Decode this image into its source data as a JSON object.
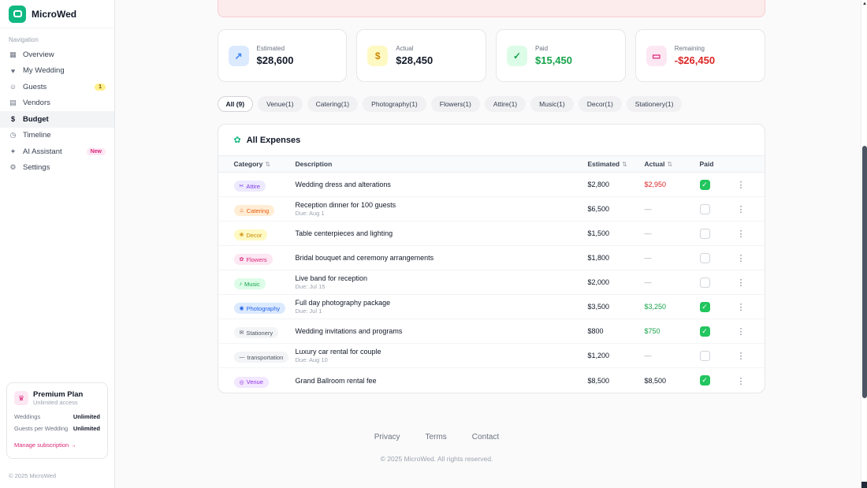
{
  "app": {
    "name": "MicroWed",
    "brand_color": "#10b981"
  },
  "sidebar": {
    "nav_label": "Navigation",
    "items": [
      {
        "label": "Overview",
        "icon": "grid-icon",
        "glyph": "▦"
      },
      {
        "label": "My Wedding",
        "icon": "heart-icon",
        "glyph": "♥"
      },
      {
        "label": "Guests",
        "icon": "users-icon",
        "glyph": "☺",
        "badge": "1",
        "badge_style": "count"
      },
      {
        "label": "Vendors",
        "icon": "store-icon",
        "glyph": "▤"
      },
      {
        "label": "Budget",
        "icon": "dollar-icon",
        "glyph": "$",
        "active": true
      },
      {
        "label": "Timeline",
        "icon": "clock-icon",
        "glyph": "◷"
      },
      {
        "label": "AI Assistant",
        "icon": "sparkles-icon",
        "glyph": "✦",
        "badge": "New",
        "badge_style": "new"
      },
      {
        "label": "Settings",
        "icon": "gear-icon",
        "glyph": "⚙"
      }
    ],
    "plan": {
      "title": "Premium Plan",
      "subtitle": "Unlimited access",
      "rows": [
        {
          "label": "Weddings",
          "value": "Unlimited"
        },
        {
          "label": "Guests per Wedding",
          "value": "Unlimited"
        }
      ],
      "manage_link": "Manage subscription →"
    },
    "copyright": "© 2025 MicroWed"
  },
  "stats": [
    {
      "label": "Estimated",
      "value": "$28,600",
      "value_color": "#111827",
      "icon": "trend-up-icon",
      "glyph": "↗",
      "icon_bg": "#dbeafe",
      "icon_color": "#3b82f6"
    },
    {
      "label": "Actual",
      "value": "$28,450",
      "value_color": "#111827",
      "icon": "dollar-icon",
      "glyph": "$",
      "icon_bg": "#fef9c3",
      "icon_color": "#ca8a04"
    },
    {
      "label": "Paid",
      "value": "$15,450",
      "value_color": "#16a34a",
      "icon": "check-circle-icon",
      "glyph": "✓",
      "icon_bg": "#dcfce7",
      "icon_color": "#16a34a"
    },
    {
      "label": "Remaining",
      "value": "-$26,450",
      "value_color": "#dc2626",
      "icon": "wallet-icon",
      "glyph": "▭",
      "icon_bg": "#fce7f3",
      "icon_color": "#db2777"
    }
  ],
  "filters": [
    {
      "label": "All (9)",
      "active": true
    },
    {
      "label": "Venue(1)"
    },
    {
      "label": "Catering(1)"
    },
    {
      "label": "Photography(1)"
    },
    {
      "label": "Flowers(1)"
    },
    {
      "label": "Attire(1)"
    },
    {
      "label": "Music(1)"
    },
    {
      "label": "Decor(1)"
    },
    {
      "label": "Stationery(1)"
    }
  ],
  "expenses": {
    "title": "All Expenses",
    "icon": "leaf-icon",
    "icon_glyph": "✿",
    "columns": [
      {
        "label": "Category",
        "sort": true
      },
      {
        "label": "Description",
        "sort": false
      },
      {
        "label": "Estimated",
        "sort": true
      },
      {
        "label": "Actual",
        "sort": true
      },
      {
        "label": "Paid",
        "sort": false
      }
    ],
    "rows": [
      {
        "category": "Attire",
        "cat_icon": "attire-icon",
        "glyph": "✂",
        "badge_bg": "#ede9fe",
        "badge_color": "#7c3aed",
        "description": "Wedding dress and alterations",
        "due": "",
        "estimated": "$2,800",
        "actual": "$2,950",
        "actual_class": "over",
        "paid": true
      },
      {
        "category": "Catering",
        "cat_icon": "catering-icon",
        "glyph": "♨",
        "badge_bg": "#ffedd5",
        "badge_color": "#ea580c",
        "description": "Reception dinner for 100 guests",
        "due": "Due: Aug 1",
        "estimated": "$6,500",
        "actual": "—",
        "actual_class": "none",
        "paid": false
      },
      {
        "category": "Decor",
        "cat_icon": "decor-icon",
        "glyph": "❋",
        "badge_bg": "#fef9c3",
        "badge_color": "#ca8a04",
        "description": "Table centerpieces and lighting",
        "due": "",
        "estimated": "$1,500",
        "actual": "—",
        "actual_class": "none",
        "paid": false
      },
      {
        "category": "Flowers",
        "cat_icon": "flowers-icon",
        "glyph": "✿",
        "badge_bg": "#fce7f3",
        "badge_color": "#db2777",
        "description": "Bridal bouquet and ceremony arrangements",
        "due": "",
        "estimated": "$1,800",
        "actual": "—",
        "actual_class": "none",
        "paid": false
      },
      {
        "category": "Music",
        "cat_icon": "music-icon",
        "glyph": "♪",
        "badge_bg": "#dcfce7",
        "badge_color": "#16a34a",
        "description": "Live band for reception",
        "due": "Due: Jul 15",
        "estimated": "$2,000",
        "actual": "—",
        "actual_class": "none",
        "paid": false
      },
      {
        "category": "Photography",
        "cat_icon": "camera-icon",
        "glyph": "◉",
        "badge_bg": "#dbeafe",
        "badge_color": "#2563eb",
        "description": "Full day photography package",
        "due": "Due: Jul 1",
        "estimated": "$3,500",
        "actual": "$3,250",
        "actual_class": "under",
        "paid": true
      },
      {
        "category": "Stationery",
        "cat_icon": "envelope-icon",
        "glyph": "✉",
        "badge_bg": "#f3f4f6",
        "badge_color": "#4b5563",
        "description": "Wedding invitations and programs",
        "due": "",
        "estimated": "$800",
        "actual": "$750",
        "actual_class": "under",
        "paid": true
      },
      {
        "category": "transportation",
        "cat_icon": "car-icon",
        "glyph": "—",
        "badge_bg": "#f3f4f6",
        "badge_color": "#4b5563",
        "description": "Luxury car rental for couple",
        "due": "Due: Aug 10",
        "estimated": "$1,200",
        "actual": "—",
        "actual_class": "none",
        "paid": false
      },
      {
        "category": "Venue",
        "cat_icon": "pin-icon",
        "glyph": "◎",
        "badge_bg": "#f3e8ff",
        "badge_color": "#9333ea",
        "description": "Grand Ballroom rental fee",
        "due": "",
        "estimated": "$8,500",
        "actual": "$8,500",
        "actual_class": "exact",
        "paid": true
      }
    ]
  },
  "footer": {
    "links": [
      "Privacy",
      "Terms",
      "Contact"
    ],
    "copyright": "© 2025 MicroWed. All rights reserved."
  }
}
